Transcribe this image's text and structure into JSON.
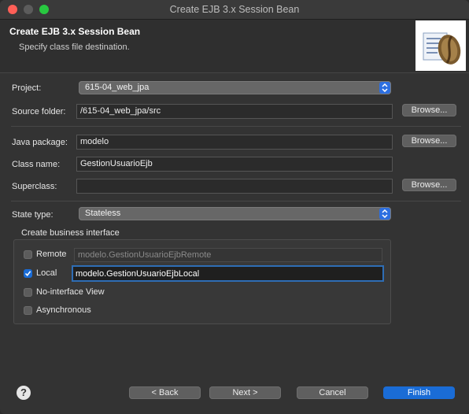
{
  "window": {
    "title": "Create EJB 3.x Session Bean"
  },
  "banner": {
    "title": "Create EJB 3.x Session Bean",
    "subtitle": "Specify class file destination."
  },
  "form": {
    "project_label": "Project:",
    "project_value": "615-04_web_jpa",
    "source_folder_label": "Source folder:",
    "source_folder_value": "/615-04_web_jpa/src",
    "java_package_label": "Java package:",
    "java_package_value": "modelo",
    "class_name_label": "Class name:",
    "class_name_value": "GestionUsuarioEjb",
    "superclass_label": "Superclass:",
    "superclass_value": "",
    "state_type_label": "State type:",
    "state_type_value": "Stateless",
    "browse_label": "Browse..."
  },
  "business_interface": {
    "title": "Create business interface",
    "remote_label": "Remote",
    "remote_checked": false,
    "remote_value": "modelo.GestionUsuarioEjbRemote",
    "local_label": "Local",
    "local_checked": true,
    "local_value": "modelo.GestionUsuarioEjbLocal",
    "no_interface_label": "No-interface View",
    "no_interface_checked": false,
    "async_label": "Asynchronous",
    "async_checked": false
  },
  "footer": {
    "help_glyph": "?",
    "back_label": "< Back",
    "next_label": "Next >",
    "cancel_label": "Cancel",
    "finish_label": "Finish"
  },
  "colors": {
    "accent": "#1a6cd6",
    "focus_ring": "#2e6db5",
    "background": "#333333"
  }
}
